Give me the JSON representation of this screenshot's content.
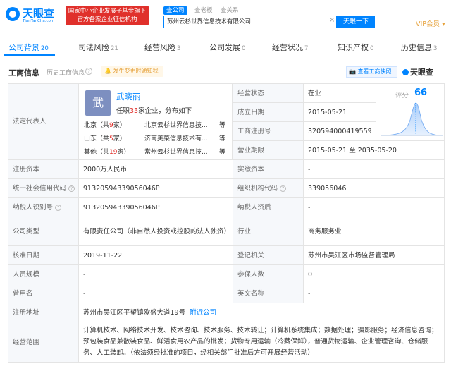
{
  "header": {
    "logo_text": "天眼查",
    "logo_sub": "TianYanCha.com",
    "gov_line1": "国家中小企业发展子基金旗下",
    "gov_line2": "官方备案企业征信机构",
    "search_tabs": [
      "查公司",
      "查老板",
      "查关系"
    ],
    "search_value": "苏州云杉世界信息技术有限公司",
    "clear_icon": "×",
    "search_button": "天眼一下",
    "vip": "VIP会员 ▾"
  },
  "tabs": [
    {
      "label": "公司背景",
      "count": "20"
    },
    {
      "label": "司法风险",
      "count": "21"
    },
    {
      "label": "经营风险",
      "count": "3"
    },
    {
      "label": "公司发展",
      "count": "0"
    },
    {
      "label": "经营状况",
      "count": "7"
    },
    {
      "label": "知识产权",
      "count": "0"
    },
    {
      "label": "历史信息",
      "count": "3"
    }
  ],
  "section": {
    "title": "工商信息",
    "history": "历史工商信息",
    "notify": "🔔 发生变更时通知我",
    "snapshot": "📷 查看工商快照",
    "brand": "天眼查"
  },
  "rep": {
    "label": "法定代表人",
    "avatar": "武",
    "name": "武晓丽",
    "desc_pre": "任职",
    "desc_num": "33",
    "desc_post": "家企业，分布如下",
    "regions": [
      {
        "name": "北京（共",
        "num": "9",
        "end": "家）",
        "company": "北京云杉世界信息技...",
        "suffix": "等"
      },
      {
        "name": "山东（共",
        "num": "5",
        "end": "家）",
        "company": "济南美菜信息技术有...",
        "suffix": "等"
      },
      {
        "name": "其他（共",
        "num": "19",
        "end": "家）",
        "company": "常州云杉世界信息技...",
        "suffix": "等"
      }
    ]
  },
  "score": {
    "label": "评分",
    "value": "66"
  },
  "right_top": [
    {
      "label": "经营状态",
      "value": "在业"
    },
    {
      "label": "成立日期",
      "value": "2015-05-21"
    },
    {
      "label": "工商注册号",
      "value": "320594000419559"
    },
    {
      "label": "营业期限",
      "value": "2015-05-21  至 2035-05-20"
    }
  ],
  "rows": {
    "reg_capital": {
      "label": "注册资本",
      "value": "2000万人民币"
    },
    "paid_capital": {
      "label": "实缴资本",
      "value": "-"
    },
    "credit_code": {
      "label": "统一社会信用代码",
      "value": "91320594339056046P"
    },
    "org_code": {
      "label": "组织机构代码",
      "value": "339056046"
    },
    "taxpayer_id": {
      "label": "纳税人识别号",
      "value": "91320594339056046P"
    },
    "taxpayer_qual": {
      "label": "纳税人资质",
      "value": "-"
    },
    "company_type": {
      "label": "公司类型",
      "value": "有限责任公司（非自然人投资或控股的法人独资）"
    },
    "industry": {
      "label": "行业",
      "value": "商务服务业"
    },
    "approval_date": {
      "label": "核准日期",
      "value": "2019-11-22"
    },
    "authority": {
      "label": "登记机关",
      "value": "苏州市吴江区市场监督管理局"
    },
    "staff_size": {
      "label": "人员规模",
      "value": "-"
    },
    "insured": {
      "label": "参保人数",
      "value": "0"
    },
    "former_name": {
      "label": "曾用名",
      "value": "-"
    },
    "english_name": {
      "label": "英文名称",
      "value": "-"
    },
    "address": {
      "label": "注册地址",
      "value": "苏州市吴江区平望镇欧盛大道19号",
      "link": "附近公司"
    },
    "scope": {
      "label": "经营范围",
      "value": "计算机技术、网络技术开发、技术咨询、技术服务、技术转让；计算机系统集成；数据处理；摄影服务；经济信息咨询；预包装食品兼散装食品、鲜活食用农产品的批发；货物专用运输（冷藏保鲜），普通货物运输、企业管理咨询、仓储服务、人工装卸。（依法须经批准的项目，经相关部门批准后方可开展经营活动）"
    }
  },
  "help_icon": "?"
}
